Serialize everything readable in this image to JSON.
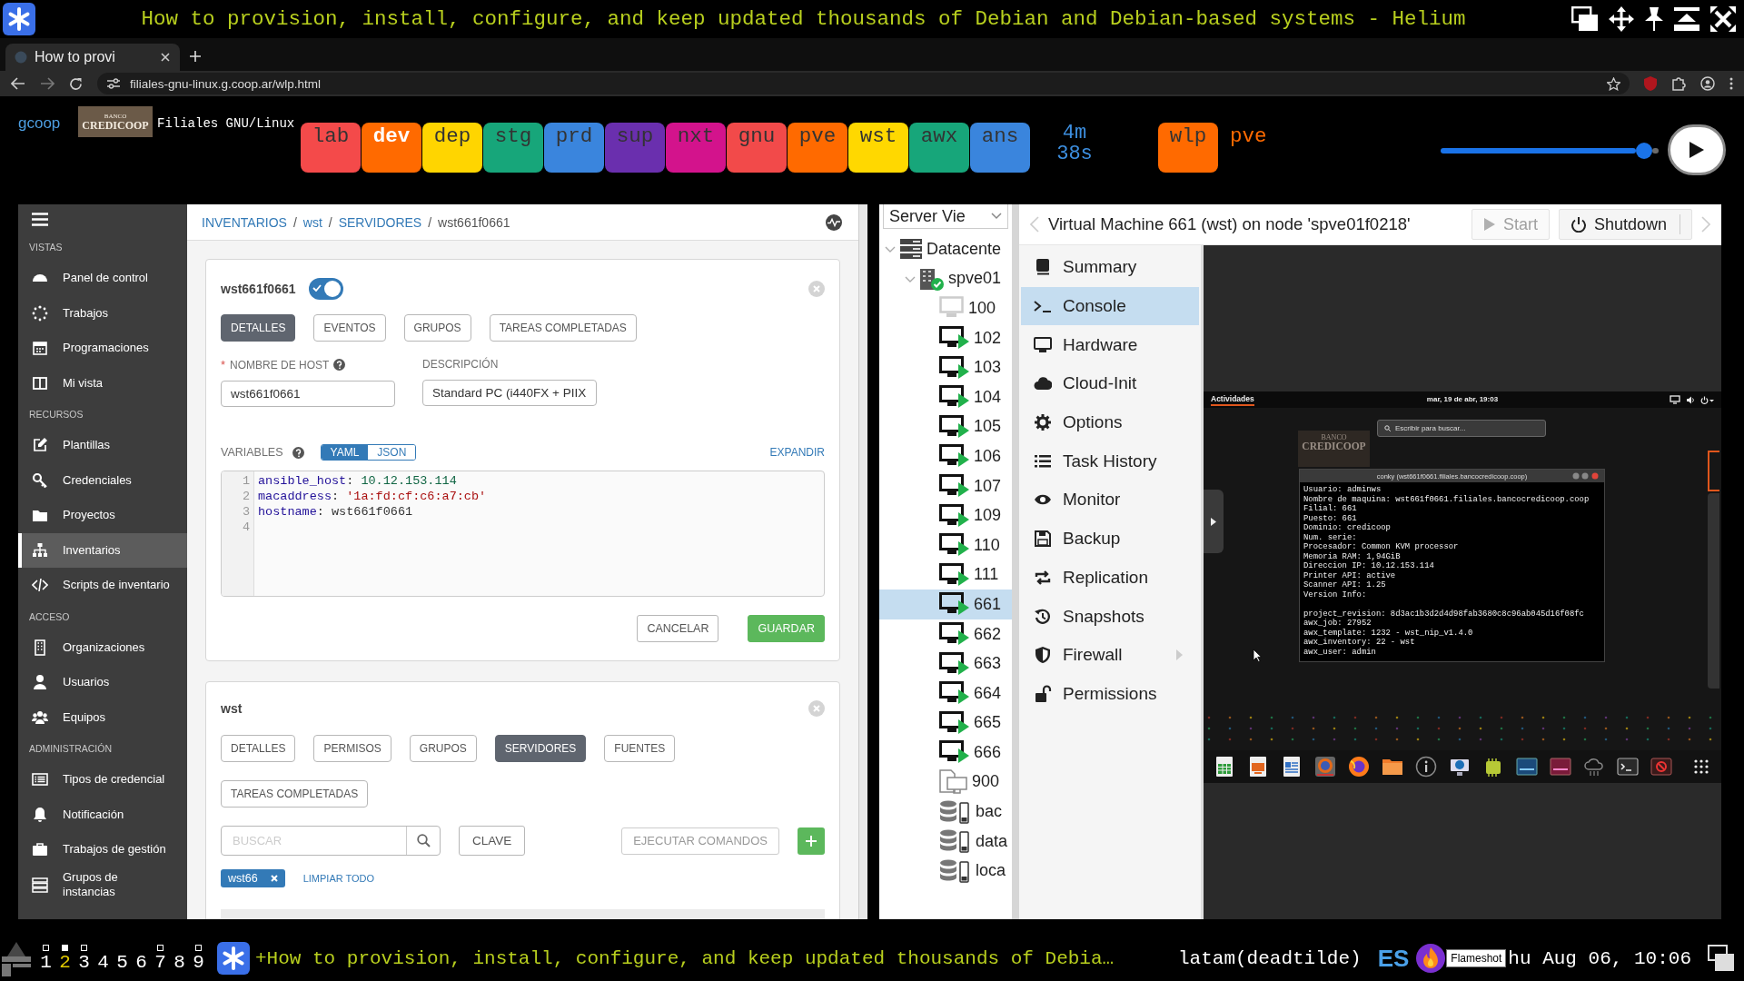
{
  "window": {
    "title": "How to provision, install, configure, and keep updated thousands of Debian and Debian-based systems - Helium"
  },
  "browser": {
    "tabs": [
      {
        "label": "How to provi",
        "selected": true
      }
    ],
    "url": "filiales-gnu-linux.g.coop.ar/wlp.html"
  },
  "site_header": {
    "logo": "gcoop",
    "bank_logo": {
      "line_1": "BANCO",
      "line_2": "CREDICOOP"
    },
    "title": "Filiales GNU/Linux",
    "tiles": [
      {
        "label": "lab",
        "color": "#f44a4a",
        "selected": false
      },
      {
        "label": "dev",
        "color": "#ff6a00",
        "selected": true
      },
      {
        "label": "dep",
        "color": "#ffd500",
        "selected": false
      },
      {
        "label": "stg",
        "color": "#17a67a",
        "selected": false
      },
      {
        "label": "prd",
        "color": "#3a85dd",
        "selected": false
      },
      {
        "label": "sup",
        "color": "#6a2fae",
        "selected": false
      },
      {
        "label": "nxt",
        "color": "#d3138c",
        "selected": false
      },
      {
        "label": "gnu",
        "color": "#f24a4a",
        "selected": false
      },
      {
        "label": "pve",
        "color": "#ff6a00",
        "selected": false
      },
      {
        "label": "wst",
        "color": "#ffd800",
        "selected": false
      },
      {
        "label": "awx",
        "color": "#17a67a",
        "selected": false
      },
      {
        "label": "ans",
        "color": "#3a85dd",
        "selected": false
      }
    ],
    "timer": "4m 38s",
    "current": {
      "label": "wlp",
      "color": "#ff6a00"
    },
    "next": "pve",
    "slider": {
      "level": 0.97
    }
  },
  "awx": {
    "sidebar": {
      "sections": [
        {
          "heading": "VISTAS",
          "items": [
            {
              "label": "Panel de control",
              "selected": false
            },
            {
              "label": "Trabajos",
              "selected": false
            },
            {
              "label": "Programaciones",
              "selected": false
            },
            {
              "label": "Mi vista",
              "selected": false
            }
          ]
        },
        {
          "heading": "RECURSOS",
          "items": [
            {
              "label": "Plantillas",
              "selected": false
            },
            {
              "label": "Credenciales",
              "selected": false
            },
            {
              "label": "Proyectos",
              "selected": false
            },
            {
              "label": "Inventarios",
              "selected": true
            },
            {
              "label": "Scripts de inventario",
              "selected": false
            }
          ]
        },
        {
          "heading": "ACCESO",
          "items": [
            {
              "label": "Organizaciones",
              "selected": false
            },
            {
              "label": "Usuarios",
              "selected": false
            },
            {
              "label": "Equipos",
              "selected": false
            }
          ]
        },
        {
          "heading": "ADMINISTRACIÓN",
          "items": [
            {
              "label": "Tipos de credencial",
              "selected": false
            },
            {
              "label": "Notificación",
              "selected": false
            },
            {
              "label": "Trabajos de gestión",
              "selected": false
            },
            {
              "label": "Grupos de instancias",
              "selected": false
            }
          ]
        }
      ]
    },
    "breadcrumb": [
      {
        "label": "INVENTARIOS",
        "kind": "link"
      },
      {
        "label": "/",
        "kind": "separator"
      },
      {
        "label": "wst",
        "kind": "link"
      },
      {
        "label": "/",
        "kind": "separator"
      },
      {
        "label": "SERVIDORES",
        "kind": "link"
      },
      {
        "label": "/",
        "kind": "separator"
      },
      {
        "label": "wst661f0661",
        "kind": "current"
      }
    ],
    "host_card": {
      "title": "wst661f0661",
      "enabled": true,
      "tabs": [
        {
          "label": "DETALLES",
          "selected": true
        },
        {
          "label": "EVENTOS",
          "selected": false
        },
        {
          "label": "GRUPOS",
          "selected": false
        },
        {
          "label": "TAREAS COMPLETADAS",
          "selected": false
        }
      ],
      "fields": [
        {
          "label": "NOMBRE DE HOST",
          "required_mark": "*",
          "help": true,
          "value": "wst661f0661"
        },
        {
          "label": "DESCRIPCIÓN",
          "help": false,
          "value": "Standard PC (i440FX + PIIX"
        }
      ],
      "variables": {
        "label": "VARIABLES",
        "formats": [
          {
            "label": "YAML",
            "selected": true
          },
          {
            "label": "JSON",
            "selected": false
          }
        ],
        "expand": "EXPANDIR",
        "lines": [
          {
            "number": "1",
            "tokens": [
              {
                "text": "ansible_host",
                "kind": "key"
              },
              {
                "text": ": ",
                "kind": "plain"
              },
              {
                "text": "10.12.153.114",
                "kind": "number"
              }
            ]
          },
          {
            "number": "2",
            "tokens": [
              {
                "text": "macaddress",
                "kind": "key"
              },
              {
                "text": ": ",
                "kind": "plain"
              },
              {
                "text": "'1a:fd:cf:c6:a7:cb'",
                "kind": "string"
              }
            ]
          },
          {
            "number": "3",
            "tokens": [
              {
                "text": "hostname",
                "kind": "key"
              },
              {
                "text": ": wst661f0661",
                "kind": "plain"
              }
            ]
          },
          {
            "number": "4"
          }
        ]
      },
      "actions": [
        {
          "label": "CANCELAR",
          "kind": "secondary"
        },
        {
          "label": "GUARDAR",
          "kind": "primary"
        }
      ]
    },
    "group_card": {
      "title": "wst",
      "tabs": [
        {
          "label": "DETALLES",
          "selected": false
        },
        {
          "label": "PERMISOS",
          "selected": false
        },
        {
          "label": "GRUPOS",
          "selected": false
        },
        {
          "label": "SERVIDORES",
          "selected": true
        },
        {
          "label": "FUENTES",
          "selected": false
        },
        {
          "label": "TAREAS COMPLETADAS",
          "selected": false
        }
      ],
      "search": {
        "placeholder": "BUSCAR"
      },
      "key_button": "CLAVE",
      "run_button": {
        "label": "EJECUTAR COMANDOS",
        "disabled": true
      },
      "tags": [
        {
          "label": "wst66"
        }
      ],
      "clear_all": "LIMPIAR TODO"
    }
  },
  "pve": {
    "view_selector": "Server Vie",
    "tree": [
      {
        "label": "Datacente",
        "kind": "datacenter",
        "expanded": true,
        "selected": false,
        "children": [
          {
            "label": "spve01",
            "kind": "node",
            "expanded": true,
            "selected": false,
            "children": [
              {
                "label": "100",
                "kind": "vm",
                "running": false,
                "selected": false
              },
              {
                "label": "102",
                "kind": "vm",
                "running": true,
                "selected": false
              },
              {
                "label": "103",
                "kind": "vm",
                "running": true,
                "selected": false
              },
              {
                "label": "104",
                "kind": "vm",
                "running": true,
                "selected": false
              },
              {
                "label": "105",
                "kind": "vm",
                "running": true,
                "selected": false
              },
              {
                "label": "106",
                "kind": "vm",
                "running": true,
                "selected": false
              },
              {
                "label": "107",
                "kind": "vm",
                "running": true,
                "selected": false
              },
              {
                "label": "109",
                "kind": "vm",
                "running": true,
                "selected": false
              },
              {
                "label": "110",
                "kind": "vm",
                "running": true,
                "selected": false
              },
              {
                "label": "111",
                "kind": "vm",
                "running": true,
                "selected": false
              },
              {
                "label": "661",
                "kind": "vm",
                "running": true,
                "selected": true
              },
              {
                "label": "662",
                "kind": "vm",
                "running": true,
                "selected": false
              },
              {
                "label": "663",
                "kind": "vm",
                "running": true,
                "selected": false
              },
              {
                "label": "664",
                "kind": "vm",
                "running": true,
                "selected": false
              },
              {
                "label": "665",
                "kind": "vm",
                "running": true,
                "selected": false
              },
              {
                "label": "666",
                "kind": "vm",
                "running": true,
                "selected": false
              },
              {
                "label": "900",
                "kind": "template",
                "selected": false
              },
              {
                "label": "bac",
                "kind": "storage",
                "selected": false
              },
              {
                "label": "data",
                "kind": "storage",
                "selected": false
              },
              {
                "label": "loca",
                "kind": "storage",
                "selected": false
              }
            ]
          }
        ]
      }
    ],
    "vm_title": "Virtual Machine 661 (wst) on node 'spve01f0218'",
    "toolbar": [
      {
        "label": "Start",
        "kind": "start",
        "disabled": true
      },
      {
        "label": "Shutdown",
        "kind": "shutdown",
        "disabled": false
      }
    ],
    "menu": [
      {
        "label": "Summary",
        "selected": false,
        "submenu": false
      },
      {
        "label": "Console",
        "selected": true,
        "submenu": false
      },
      {
        "label": "Hardware",
        "selected": false,
        "submenu": false
      },
      {
        "label": "Cloud-Init",
        "selected": false,
        "submenu": false
      },
      {
        "label": "Options",
        "selected": false,
        "submenu": false
      },
      {
        "label": "Task History",
        "selected": false,
        "submenu": false
      },
      {
        "label": "Monitor",
        "selected": false,
        "submenu": false
      },
      {
        "label": "Backup",
        "selected": false,
        "submenu": false
      },
      {
        "label": "Replication",
        "selected": false,
        "submenu": false
      },
      {
        "label": "Snapshots",
        "selected": false,
        "submenu": false
      },
      {
        "label": "Firewall",
        "selected": false,
        "submenu": true
      },
      {
        "label": "Permissions",
        "selected": false,
        "submenu": false
      }
    ],
    "console": {
      "activities": "Actividades",
      "clock": "mar, 19 de abr, 19:03",
      "search_placeholder": "Escribir para buscar...",
      "logo": {
        "line_1": "BANCO",
        "line_2": "CREDICOOP"
      },
      "conky": {
        "title": "conky (wst661f0661.filiales.bancocredicoop.coop)",
        "lines": [
          "Usuario: adminws",
          "Nombre de maquina: wst661f0661.filiales.bancocredicoop.coop",
          "Filial: 661",
          "Puesto: 661",
          "Dominio: credicoop",
          "Num. serie:",
          "Procesador: Common KVM processor",
          "Memoria RAM: 1,94GiB",
          "Direccion IP: 10.12.153.114",
          "Printer API: active",
          "Scanner API: 1.25",
          "Version Info:"
        ],
        "extra_lines": [
          "project_revision: 8d3ac1b3d2d4d98fab3680c8c96ab045d16f08fc",
          "awx_job: 27952",
          "awx_template: 1232 - wst_nip_v1.4.0",
          "awx_inventory: 22 - wst",
          "awx_user: admin"
        ]
      }
    }
  },
  "taskbar": {
    "workspaces": [
      {
        "label": "1",
        "selected": false,
        "occupied": true
      },
      {
        "label": "2",
        "selected": true,
        "occupied": true
      },
      {
        "label": "3",
        "selected": false,
        "occupied": true
      },
      {
        "label": "4",
        "selected": false,
        "occupied": false
      },
      {
        "label": "5",
        "selected": false,
        "occupied": false
      },
      {
        "label": "6",
        "selected": false,
        "occupied": false
      },
      {
        "label": "7",
        "selected": false,
        "occupied": true
      },
      {
        "label": "8",
        "selected": false,
        "occupied": false
      },
      {
        "label": "9",
        "selected": false,
        "occupied": true
      }
    ],
    "window_title": "+How to provision, install, configure, and keep updated thousands of Debia…",
    "keyboard_layout": "latam(deadtilde)",
    "language": "ES",
    "tooltip": "Flameshot",
    "clock": "hu Aug 06, 10:06"
  }
}
